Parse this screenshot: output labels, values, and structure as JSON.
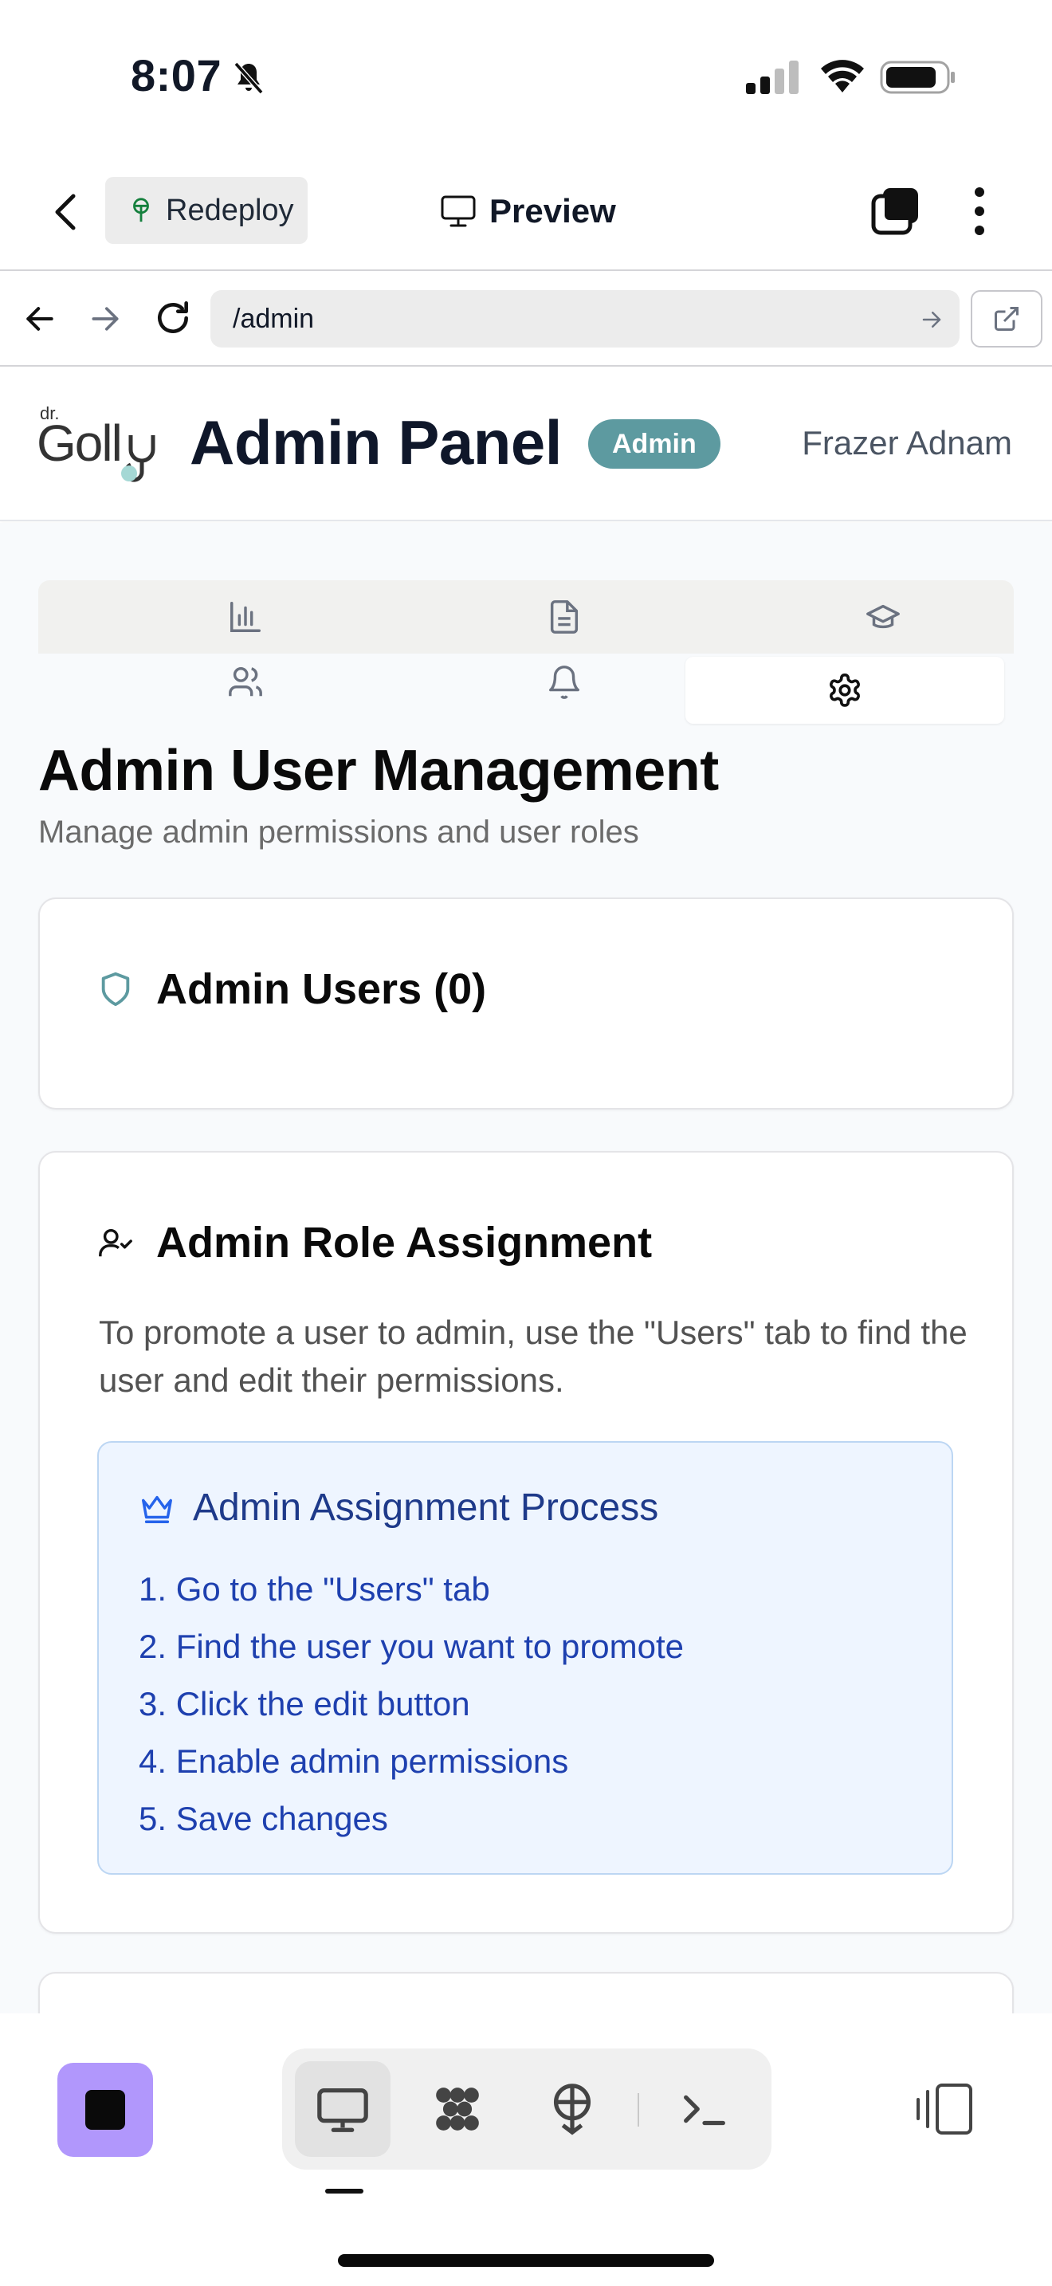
{
  "status_bar": {
    "time": "8:07"
  },
  "top_bar": {
    "redeploy_label": "Redeploy",
    "preview_label": "Preview"
  },
  "url_bar": {
    "url": "/admin"
  },
  "app_header": {
    "logo_text": "dr. Golly",
    "title": "Admin Panel",
    "role_badge": "Admin",
    "user_name": "Frazer Adnam",
    "badge_color": "#5d9aa0"
  },
  "tabs": [
    {
      "icon": "bar-chart-icon",
      "active": false
    },
    {
      "icon": "document-icon",
      "active": false
    },
    {
      "icon": "graduation-cap-icon",
      "active": false
    },
    {
      "icon": "users-icon",
      "active": false
    },
    {
      "icon": "bell-icon",
      "active": false
    },
    {
      "icon": "gear-icon",
      "active": true
    }
  ],
  "page": {
    "title": "Admin User Management",
    "subtitle": "Manage admin permissions and user roles"
  },
  "admin_users_card": {
    "title": "Admin Users (0)",
    "icon": "shield-icon"
  },
  "role_assignment_card": {
    "title": "Admin Role Assignment",
    "icon": "user-check-icon",
    "description": "To promote a user to admin, use the \"Users\" tab to find the user and edit their permissions.",
    "process": {
      "title": "Admin Assignment Process",
      "icon": "crown-icon",
      "steps": [
        "1. Go to the \"Users\" tab",
        "2. Find the user you want to promote",
        "3. Click the edit button",
        "4. Enable admin permissions",
        "5. Save changes"
      ]
    }
  },
  "bottom_toolbar": {
    "accent_color": "#b197fc",
    "tools": [
      "preview-icon",
      "agent-icon",
      "deploy-icon",
      "shell-icon"
    ]
  }
}
